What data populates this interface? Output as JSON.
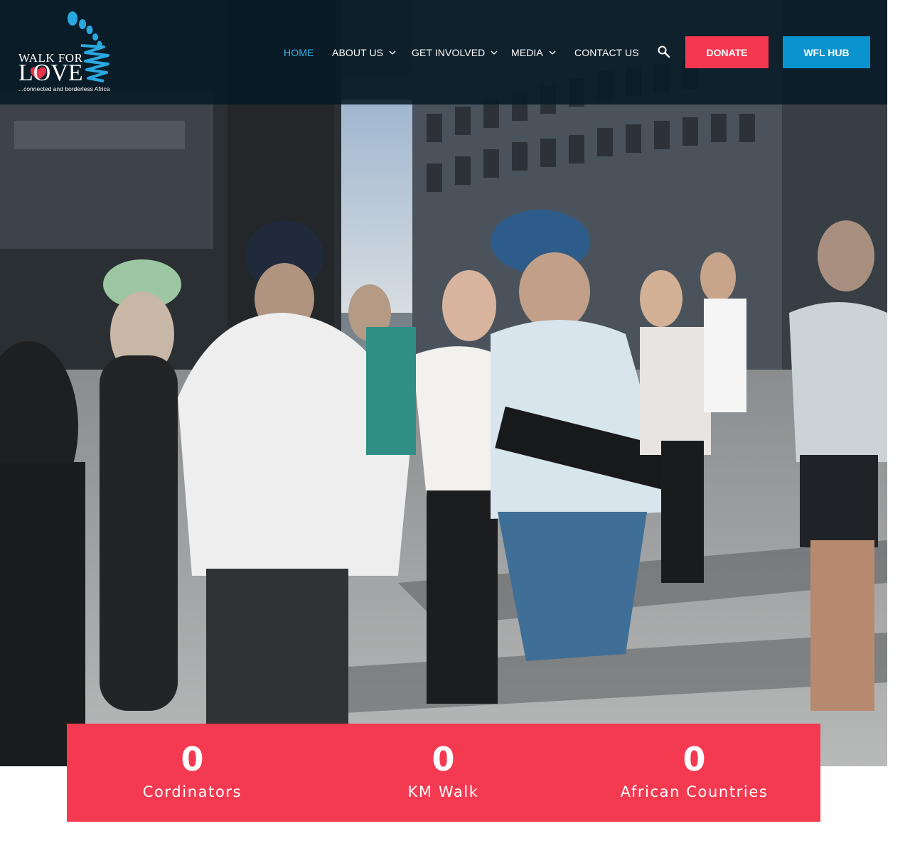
{
  "brand": {
    "logo_line1": "WALK FOR",
    "logo_line2": "LOVE",
    "tagline": "...connected and borderless Africa",
    "accent_blue": "#3ab2e6",
    "accent_red": "#f5374f",
    "hub_blue": "#0a94cf"
  },
  "nav": {
    "items": [
      {
        "label": "HOME",
        "active": true,
        "has_dropdown": false
      },
      {
        "label": "ABOUT US",
        "active": false,
        "has_dropdown": true
      },
      {
        "label": "GET INVOLVED",
        "active": false,
        "has_dropdown": true
      },
      {
        "label": "MEDIA",
        "active": false,
        "has_dropdown": true
      },
      {
        "label": "CONTACT US",
        "active": false,
        "has_dropdown": false
      }
    ],
    "search_icon": "search-icon",
    "donate_label": "DONATE",
    "hub_label": "WFL HUB"
  },
  "hero": {
    "image_description_icon": "hero-photo"
  },
  "stats": [
    {
      "value": "0",
      "label": "Cordinators"
    },
    {
      "value": "0",
      "label": "KM Walk"
    },
    {
      "value": "0",
      "label": "African Countries"
    }
  ]
}
